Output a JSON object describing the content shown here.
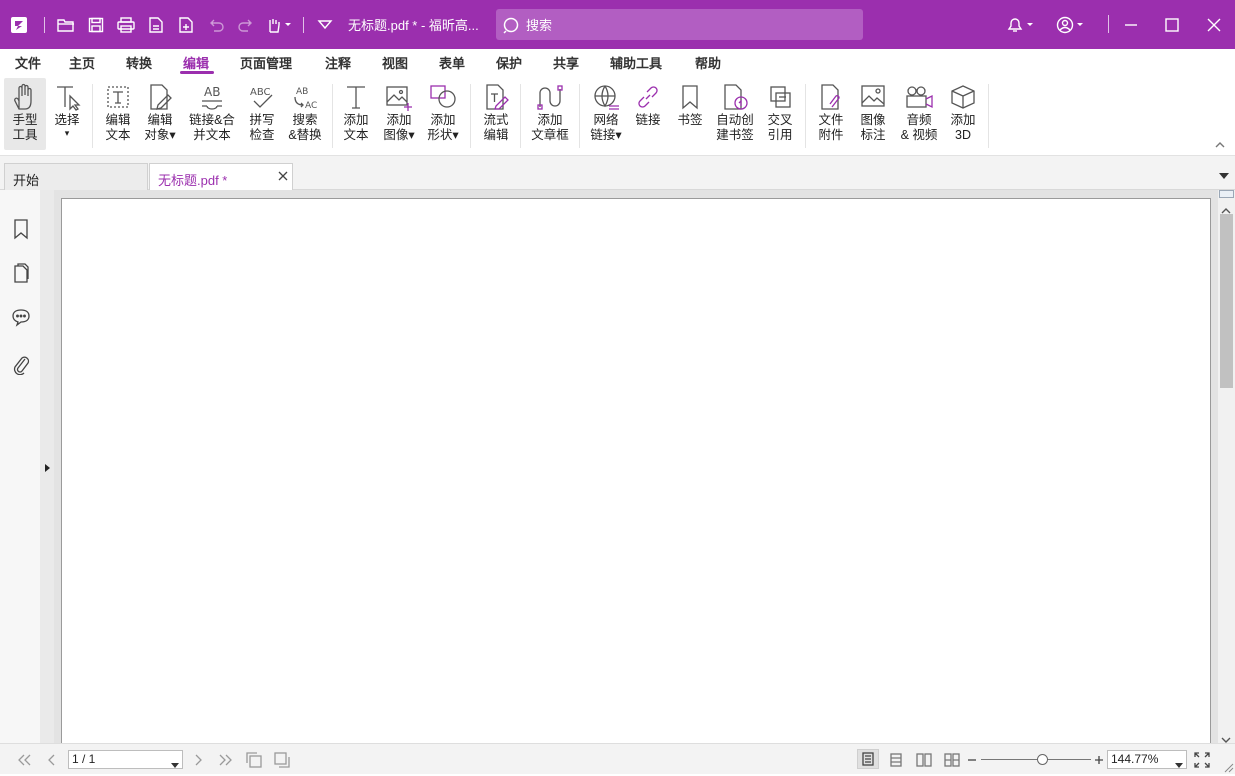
{
  "app": {
    "document_title": "无标题.pdf * - 福昕高...",
    "search_placeholder": "搜索",
    "accent_color": "#9b2fae"
  },
  "menu": {
    "items": [
      "文件",
      "主页",
      "转换",
      "编辑",
      "页面管理",
      "注释",
      "视图",
      "表单",
      "保护",
      "共享",
      "辅助工具",
      "帮助"
    ],
    "active": "编辑"
  },
  "ribbon": {
    "hand_tool": [
      "手型",
      "工具"
    ],
    "select": [
      "选择",
      ""
    ],
    "edit_text": [
      "编辑",
      "文本"
    ],
    "edit_object": [
      "编辑",
      "对象▾"
    ],
    "link_merge_text": [
      "链接&合",
      "并文本"
    ],
    "spell_check": [
      "拼写",
      "检查"
    ],
    "search_replace": [
      "搜索",
      "&替换"
    ],
    "add_text": [
      "添加",
      "文本"
    ],
    "add_image": [
      "添加",
      "图像▾"
    ],
    "add_shape": [
      "添加",
      "形状▾"
    ],
    "flow_edit": [
      "流式",
      "编辑"
    ],
    "add_article_box": [
      "添加",
      "文章框"
    ],
    "web_link": [
      "网络",
      "链接▾"
    ],
    "link": [
      "链接",
      ""
    ],
    "bookmark": [
      "书签",
      ""
    ],
    "auto_bookmark": [
      "自动创",
      "建书签"
    ],
    "cross_reference": [
      "交叉",
      "引用"
    ],
    "file_attachment": [
      "文件",
      "附件"
    ],
    "image_annotation": [
      "图像",
      "标注"
    ],
    "audio_video": [
      "音频",
      "& 视频"
    ],
    "add_3d": [
      "添加",
      "3D"
    ]
  },
  "tabs": {
    "start": "开始",
    "document": "无标题.pdf *"
  },
  "status": {
    "page_indicator": "1 / 1",
    "zoom": "144.77%",
    "zoom_level": 0.55
  }
}
